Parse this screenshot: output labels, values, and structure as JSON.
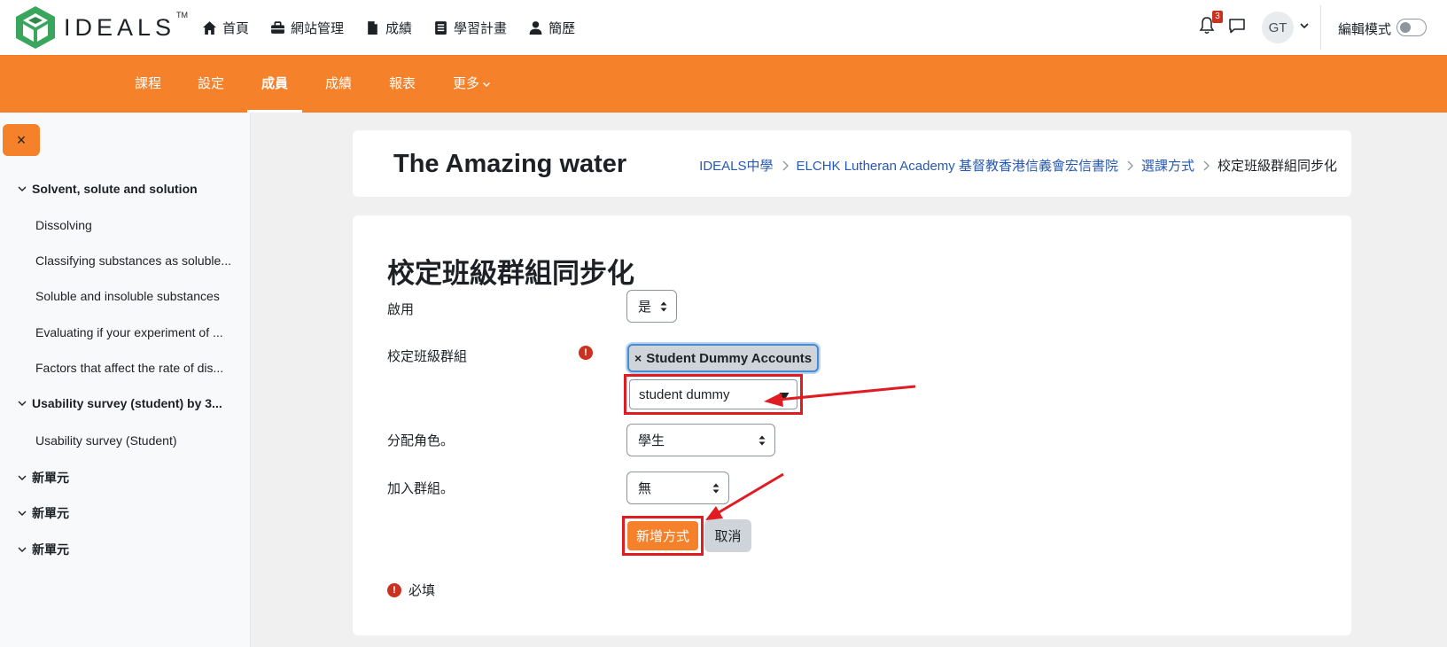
{
  "brand": {
    "name": "IDEALS",
    "tm": "TM"
  },
  "primary_nav": [
    {
      "label": "首頁",
      "icon": "home-icon"
    },
    {
      "label": "網站管理",
      "icon": "toolbox-icon"
    },
    {
      "label": "成績",
      "icon": "file-icon"
    },
    {
      "label": "學習計畫",
      "icon": "notebook-icon"
    },
    {
      "label": "簡歷",
      "icon": "user-icon"
    }
  ],
  "user_menu": {
    "notification_count": "3",
    "avatar_initials": "GT",
    "edit_mode_label": "編輯模式"
  },
  "secondary_nav": [
    {
      "label": "課程"
    },
    {
      "label": "設定"
    },
    {
      "label": "成員",
      "active": true
    },
    {
      "label": "成績"
    },
    {
      "label": "報表"
    },
    {
      "label": "更多"
    }
  ],
  "drawer": {
    "close_label": "×",
    "items": [
      {
        "type": "section",
        "label": "Solvent, solute and solution"
      },
      {
        "type": "activity",
        "label": "Dissolving"
      },
      {
        "type": "activity",
        "label": "Classifying substances as soluble..."
      },
      {
        "type": "activity",
        "label": "Soluble and insoluble substances"
      },
      {
        "type": "activity",
        "label": "Evaluating if your experiment of ..."
      },
      {
        "type": "activity",
        "label": "Factors that affect the rate of dis..."
      },
      {
        "type": "section",
        "label": "Usability survey (student) by 3..."
      },
      {
        "type": "activity",
        "label": "Usability survey (Student)"
      },
      {
        "type": "section",
        "label": "新單元"
      },
      {
        "type": "section",
        "label": "新單元"
      },
      {
        "type": "section",
        "label": "新單元"
      }
    ]
  },
  "header": {
    "course_title": "The Amazing water",
    "breadcrumb": [
      {
        "label": "IDEALS中學"
      },
      {
        "label": "ELCHK Lutheran Academy 基督教香港信義會宏信書院"
      },
      {
        "label": "選課方式"
      },
      {
        "label": "校定班級群組同步化"
      }
    ]
  },
  "form": {
    "title": "校定班級群組同步化",
    "enable_label": "啟用",
    "enable_value": "是",
    "cohort_label": "校定班級群組",
    "cohort_selected": "Student Dummy Accounts",
    "cohort_search_value": "student dummy",
    "role_label": "分配角色。",
    "role_value": "學生",
    "group_label": "加入群組。",
    "group_value": "無",
    "submit_label": "新增方式",
    "cancel_label": "取消",
    "required_icon_text": "!",
    "required_note": "必填"
  },
  "annotation_color": "#e11b22",
  "accent_color": "#f5812a"
}
